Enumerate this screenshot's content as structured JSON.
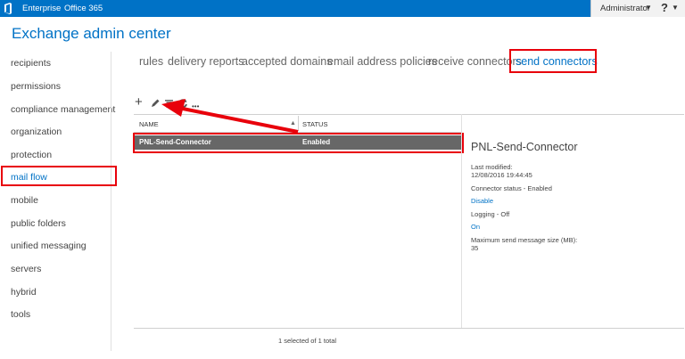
{
  "topbar": {
    "links": [
      "Enterprise",
      "Office 365"
    ],
    "user": "Administrator",
    "help": "?"
  },
  "page_title": "Exchange admin center",
  "nav": {
    "items": [
      "recipients",
      "permissions",
      "compliance management",
      "organization",
      "protection",
      "mail flow",
      "mobile",
      "public folders",
      "unified messaging",
      "servers",
      "hybrid",
      "tools"
    ],
    "selected": "mail flow"
  },
  "tabs": {
    "items": [
      "rules",
      "delivery reports",
      "accepted domains",
      "email address policies",
      "receive connectors",
      "send connectors"
    ],
    "active": "send connectors"
  },
  "toolbar": {
    "icons": [
      "add-icon",
      "edit-icon",
      "delete-icon",
      "refresh-icon",
      "more-icon"
    ],
    "more_label": "•••"
  },
  "table": {
    "columns": [
      "NAME",
      "STATUS"
    ],
    "rows": [
      {
        "name": "PNL-Send-Connector",
        "status": "Enabled"
      }
    ],
    "footer": "1 selected of 1 total"
  },
  "details": {
    "title": "PNL-Send-Connector",
    "last_modified_label": "Last modified:",
    "last_modified_value": "12/08/2016 19:44:45",
    "connector_status": "Connector status - Enabled",
    "disable_link": "Disable",
    "logging": "Logging - Off",
    "on_link": "On",
    "max_size_label": "Maximum send message size (MB):",
    "max_size_value": "35"
  },
  "colors": {
    "accent": "#0072c6",
    "highlight": "#e8000b",
    "selected_row": "#676767"
  }
}
